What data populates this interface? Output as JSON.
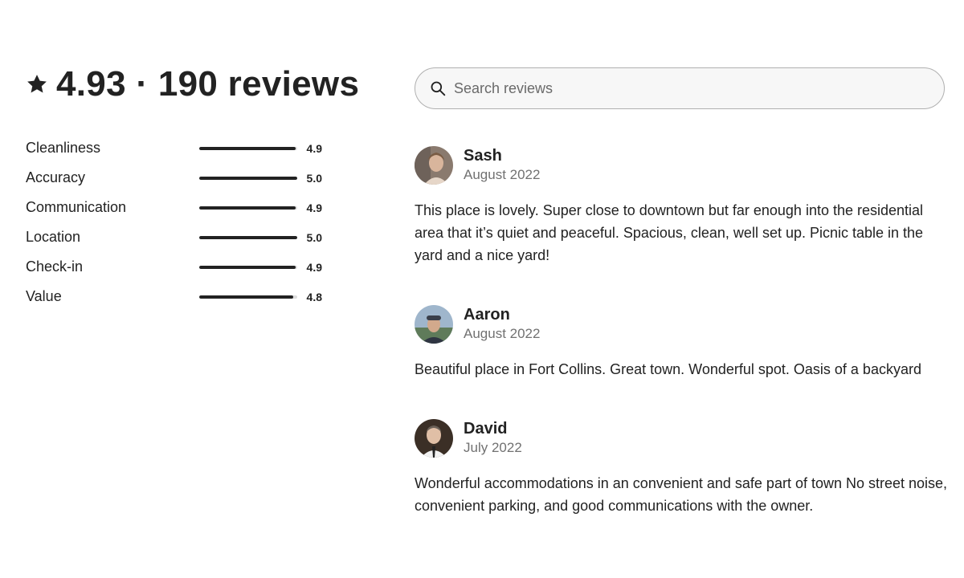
{
  "summary": {
    "text": "4.93 · 190 reviews",
    "icon": "star-icon"
  },
  "ratings": [
    {
      "label": "Cleanliness",
      "value": "4.9",
      "score": 4.9
    },
    {
      "label": "Accuracy",
      "value": "5.0",
      "score": 5.0
    },
    {
      "label": "Communication",
      "value": "4.9",
      "score": 4.9
    },
    {
      "label": "Location",
      "value": "5.0",
      "score": 5.0
    },
    {
      "label": "Check-in",
      "value": "4.9",
      "score": 4.9
    },
    {
      "label": "Value",
      "value": "4.8",
      "score": 4.8
    }
  ],
  "search": {
    "placeholder": "Search reviews",
    "value": "",
    "icon": "search-icon"
  },
  "reviews": [
    {
      "name": "Sash",
      "date": "August 2022",
      "text": "This place is lovely. Super close to downtown but far enough into the residential area that it’s quiet and peaceful. Spacious, clean, well set up. Picnic table in the yard and a nice yard!"
    },
    {
      "name": "Aaron",
      "date": "August 2022",
      "text": "Beautiful place in Fort Collins. Great town. Wonderful spot. Oasis of a backyard"
    },
    {
      "name": "David",
      "date": "July 2022",
      "text": "Wonderful accommodations in an convenient and safe part of town No street noise, convenient parking, and good communications with the owner."
    }
  ],
  "colors": {
    "text": "#222222",
    "muted": "#717171",
    "bar_track": "#dddddd",
    "bar_fill": "#222222",
    "search_border": "#b0b0b0"
  }
}
